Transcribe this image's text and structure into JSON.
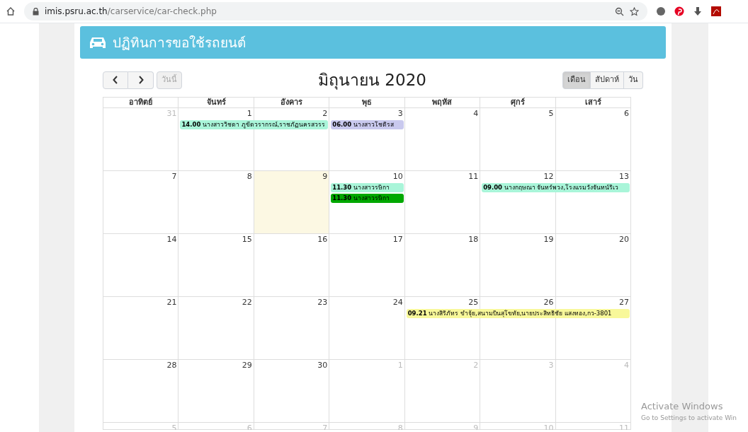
{
  "browser": {
    "url_host": "imis.psru.ac.th",
    "url_path": "/carservice/car-check.php"
  },
  "header": {
    "title": "ปฏิทินการขอใช้รถยนต์"
  },
  "calendar": {
    "today_button": {
      "label": "วันนี้",
      "disabled": true
    },
    "title": "มิถุนายน 2020",
    "views": [
      {
        "label": "เดือน",
        "selected": true
      },
      {
        "label": "สัปดาห์",
        "selected": false
      },
      {
        "label": "วัน",
        "selected": false
      }
    ],
    "weekdays": [
      "อาทิตย์",
      "จันทร์",
      "อังคาร",
      "พุธ",
      "พฤหัส",
      "ศุกร์",
      "เสาร์"
    ],
    "weeks": [
      {
        "days": [
          {
            "number": "31",
            "other_month": true,
            "today": false
          },
          {
            "number": "1",
            "other_month": false,
            "today": false,
            "events": [
              {
                "kind": "start",
                "text": "**14.00** นางสาววิชดา  ภูขีดวรากรณ์,ราชภัฏนครสวรร",
                "color": "#a9f5d9"
              }
            ]
          },
          {
            "number": "2",
            "other_month": false,
            "today": false,
            "events": [
              {
                "kind": "continued"
              }
            ]
          },
          {
            "number": "3",
            "other_month": false,
            "today": false,
            "events": [
              {
                "kind": "start",
                "text": "**06.00** นางสาวโชติรส",
                "color": "#c9c9ee"
              }
            ]
          },
          {
            "number": "4",
            "other_month": false,
            "today": false
          },
          {
            "number": "5",
            "other_month": false,
            "today": false
          },
          {
            "number": "6",
            "other_month": false,
            "today": false
          }
        ]
      },
      {
        "days": [
          {
            "number": "7",
            "other_month": false,
            "today": false
          },
          {
            "number": "8",
            "other_month": false,
            "today": false
          },
          {
            "number": "9",
            "other_month": false,
            "today": true
          },
          {
            "number": "10",
            "other_month": false,
            "today": false,
            "events": [
              {
                "kind": "start",
                "text": "**11.30** นางสาวรษิกา",
                "color": "#a9f5d9"
              },
              {
                "kind": "start",
                "text": "**11.30** นางสาวรษิกา",
                "color": "#00a800"
              }
            ]
          },
          {
            "number": "11",
            "other_month": false,
            "today": false
          },
          {
            "number": "12",
            "other_month": false,
            "today": false,
            "events": [
              {
                "kind": "start",
                "text": "**09.00** นางกฤษณา  จันทร์พวง,โรงแรมวังจันทน์ริเว",
                "color": "#a9f5d9"
              }
            ]
          },
          {
            "number": "13",
            "other_month": false,
            "today": false,
            "events": [
              {
                "kind": "continued"
              }
            ]
          }
        ]
      },
      {
        "days": [
          {
            "number": "14",
            "other_month": false,
            "today": false
          },
          {
            "number": "15",
            "other_month": false,
            "today": false
          },
          {
            "number": "16",
            "other_month": false,
            "today": false
          },
          {
            "number": "17",
            "other_month": false,
            "today": false
          },
          {
            "number": "18",
            "other_month": false,
            "today": false
          },
          {
            "number": "19",
            "other_month": false,
            "today": false
          },
          {
            "number": "20",
            "other_month": false,
            "today": false
          }
        ]
      },
      {
        "days": [
          {
            "number": "21",
            "other_month": false,
            "today": false
          },
          {
            "number": "22",
            "other_month": false,
            "today": false
          },
          {
            "number": "23",
            "other_month": false,
            "today": false
          },
          {
            "number": "24",
            "other_month": false,
            "today": false
          },
          {
            "number": "25",
            "other_month": false,
            "today": false,
            "events": [
              {
                "kind": "start",
                "text": "**09.21** นางสิริภัทร  ขำจุ้ย,สนามบินสุโขทัย,นายประสิทธิชัย แสงทอง,กว-3801",
                "color": "#f8f89a"
              }
            ]
          },
          {
            "number": "26",
            "other_month": false,
            "today": false,
            "events": [
              {
                "kind": "continued"
              }
            ]
          },
          {
            "number": "27",
            "other_month": false,
            "today": false,
            "events": [
              {
                "kind": "continued"
              }
            ]
          }
        ]
      },
      {
        "days": [
          {
            "number": "28",
            "other_month": false,
            "today": false
          },
          {
            "number": "29",
            "other_month": false,
            "today": false
          },
          {
            "number": "30",
            "other_month": false,
            "today": false
          },
          {
            "number": "1",
            "other_month": true,
            "today": false
          },
          {
            "number": "2",
            "other_month": true,
            "today": false
          },
          {
            "number": "3",
            "other_month": true,
            "today": false
          },
          {
            "number": "4",
            "other_month": true,
            "today": false
          }
        ]
      },
      {
        "days": [
          {
            "number": "5",
            "other_month": true,
            "today": false
          },
          {
            "number": "6",
            "other_month": true,
            "today": false
          },
          {
            "number": "7",
            "other_month": true,
            "today": false
          },
          {
            "number": "8",
            "other_month": true,
            "today": false
          },
          {
            "number": "9",
            "other_month": true,
            "today": false
          },
          {
            "number": "10",
            "other_month": true,
            "today": false
          },
          {
            "number": "11",
            "other_month": true,
            "today": false
          }
        ]
      }
    ]
  },
  "os_overlay": {
    "title": "Activate Windows",
    "subtitle": "Go to Settings to activate Win"
  }
}
